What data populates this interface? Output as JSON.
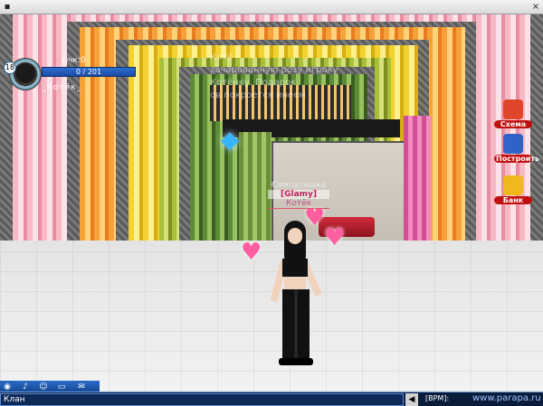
{
  "window": {
    "close_glyph": "×"
  },
  "player": {
    "level": "18",
    "points_label": "Очк:0",
    "points_value": "0 / 201",
    "name": "_Котёк_",
    "avatar_icon": "player-avatar-icon"
  },
  "chat_overlay": [
    "Котё",
    "зачарованную розу игроку",
    "Котёнку. Подарок",
    "ов покроется инеем"
  ],
  "nametag": {
    "status": "Симпатяшка",
    "clan": "[Glamy]",
    "nick": "Котёк"
  },
  "side_buttons": [
    {
      "label": "Схема",
      "icon": "scheme-icon",
      "color": "#e0462c"
    },
    {
      "label": "Построить",
      "icon": "build-icon",
      "color": "#2f63c8"
    },
    {
      "label": "Банк",
      "icon": "bank-icon",
      "color": "#f0b81a"
    }
  ],
  "toolbar": {
    "icons": [
      "menu-icon",
      "sound-icon",
      "smiley-icon",
      "keyboard-icon",
      "mail-icon"
    ]
  },
  "chatbar": {
    "channel": "Клан",
    "bpm": "[BPM]:",
    "site": "www.parapa.ru"
  }
}
